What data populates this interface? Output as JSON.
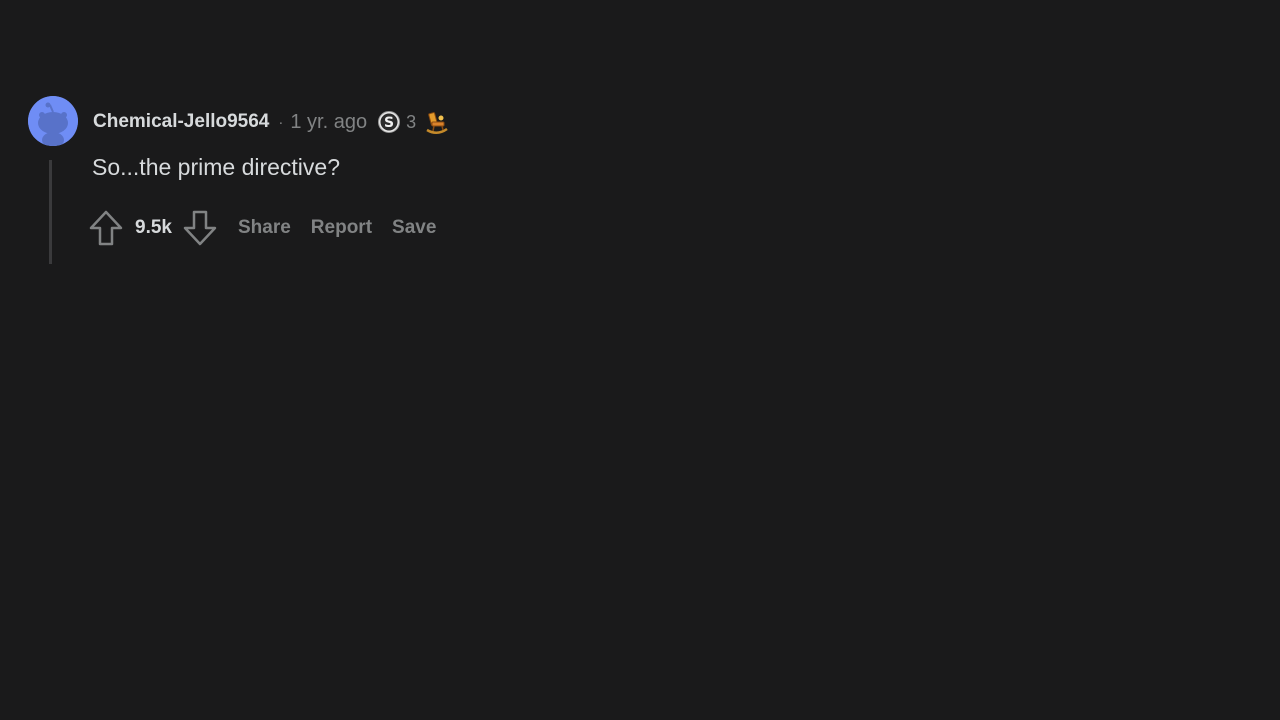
{
  "comment": {
    "author": "Chemical-Jello9564",
    "separator": "·",
    "timestamp": "1 yr. ago",
    "awards": [
      {
        "icon": "silver-award-icon",
        "count": "3"
      },
      {
        "icon": "rocking-chair-award-icon",
        "count": ""
      }
    ],
    "body": "So...the prime directive?",
    "score": "9.5k",
    "actions": {
      "share_label": "Share",
      "report_label": "Report",
      "save_label": "Save"
    }
  },
  "colors": {
    "background": "#1a1a1b",
    "text_primary": "#d7dadc",
    "text_muted": "#818384",
    "avatar": "#6f8df5",
    "thread_line": "#3a3a3c"
  }
}
